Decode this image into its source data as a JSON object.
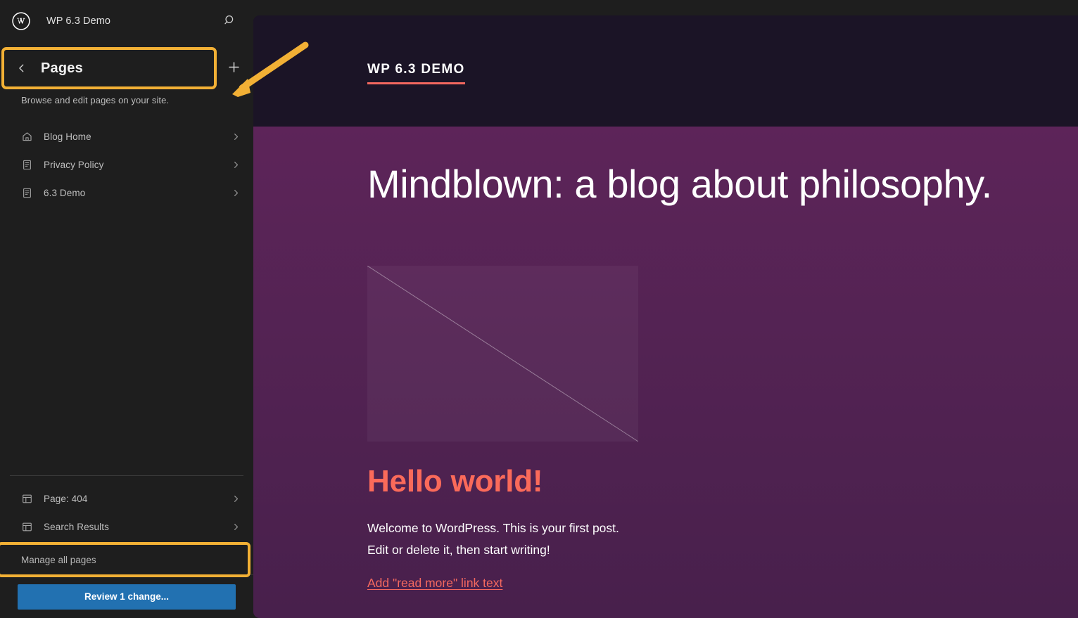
{
  "sidebar": {
    "logo_icon": "wordpress-logo-icon",
    "site_title": "WP 6.3 Demo",
    "search_icon": "search-icon",
    "back_icon": "chevron-left-icon",
    "panel_title": "Pages",
    "add_icon": "plus-icon",
    "panel_subtitle": "Browse and edit pages on your site.",
    "pages": [
      {
        "label": "Blog Home",
        "icon": "home-icon",
        "chevron": "chevron-right-icon"
      },
      {
        "label": "Privacy Policy",
        "icon": "document-icon",
        "chevron": "chevron-right-icon"
      },
      {
        "label": "6.3 Demo",
        "icon": "document-icon",
        "chevron": "chevron-right-icon"
      }
    ],
    "templates": [
      {
        "label": "Page: 404",
        "icon": "template-icon",
        "chevron": "chevron-right-icon"
      },
      {
        "label": "Search Results",
        "icon": "template-icon",
        "chevron": "chevron-right-icon"
      }
    ],
    "manage_all_label": "Manage all pages",
    "review_button_label": "Review 1 change...",
    "highlight_color": "#F2B035",
    "primary_button_color": "#2271B1"
  },
  "annotations": {
    "arrow_color": "#F2B035",
    "arrow_target": "add-new-page-button"
  },
  "canvas": {
    "header": {
      "brand": "WP 6.3 Demo",
      "brand_underline_color": "#F4685F",
      "nav_clipped": "6"
    },
    "hero_heading": "Mindblown: a blog about philosophy.",
    "featured_image_alt": "broken-image-placeholder",
    "post": {
      "title": "Hello world!",
      "title_color": "#FA6A5A",
      "body_line_1": "Welcome to WordPress. This is your first post.",
      "body_line_2": "Edit or delete it, then start writing!",
      "read_more_label": "Add \"read more\" link text"
    },
    "background_top": "#1B1426",
    "background_body_top": "#5D2459",
    "background_body_bottom": "#48204C"
  }
}
